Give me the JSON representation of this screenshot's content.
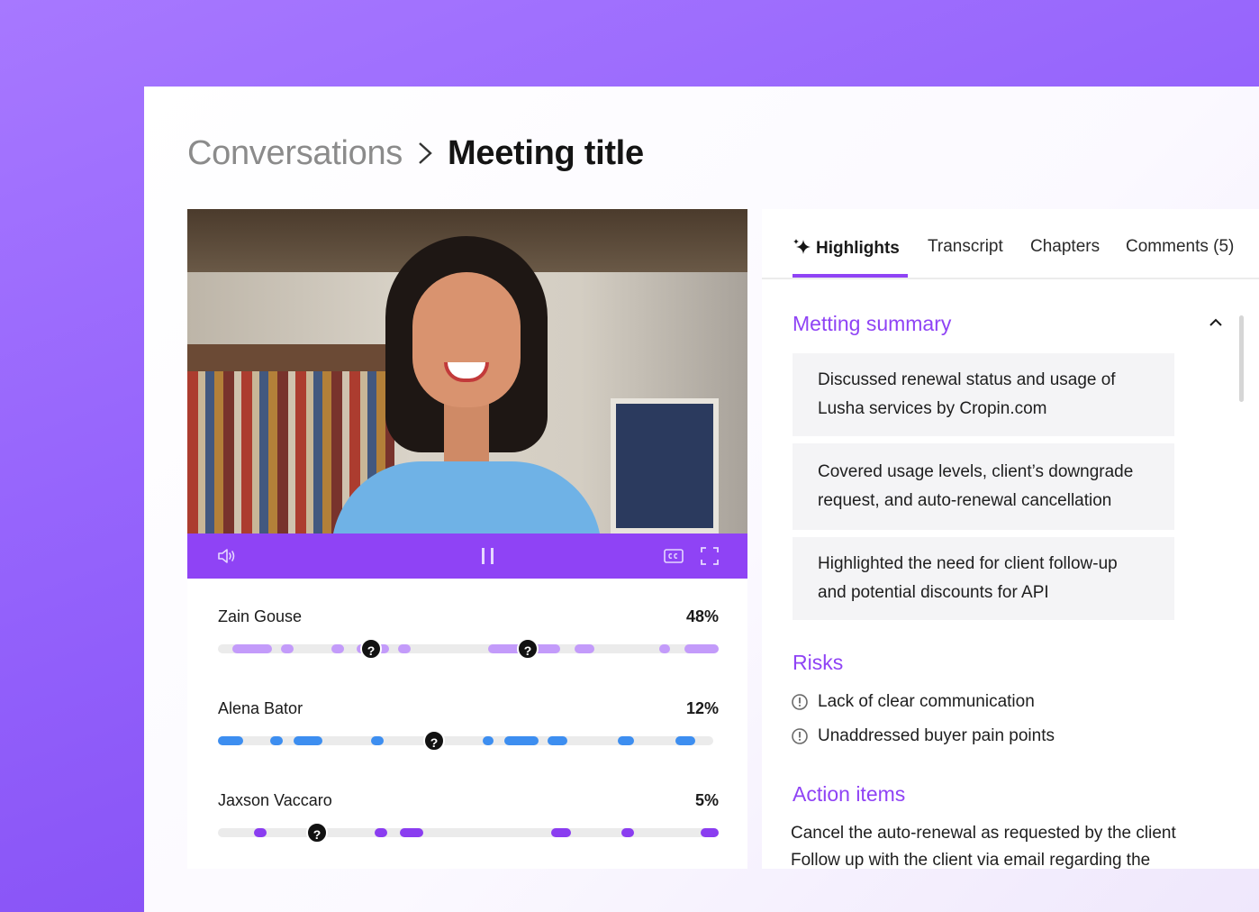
{
  "breadcrumb": {
    "parent": "Conversations",
    "current": "Meeting title"
  },
  "player": {
    "controls": [
      "volume-icon",
      "pause-icon",
      "captions-icon",
      "fullscreen-icon"
    ]
  },
  "colors": {
    "accent": "#8f43f5",
    "speaker_lilac": "#c39bfa",
    "speaker_blue": "#3d8ef0",
    "speaker_violet": "#8a3df0"
  },
  "speakers": [
    {
      "name": "Zain Gouse",
      "percent": "48%"
    },
    {
      "name": "Alena Bator",
      "percent": "12%"
    },
    {
      "name": "Jaxson Vaccaro",
      "percent": "5%"
    }
  ],
  "question_marker": "?",
  "tabs": [
    {
      "label": "Highlights",
      "active": true,
      "icon": "sparkle-icon"
    },
    {
      "label": "Transcript",
      "active": false
    },
    {
      "label": "Chapters",
      "active": false
    },
    {
      "label": "Comments (5)",
      "active": false
    }
  ],
  "summary": {
    "title": "Metting summary",
    "items": [
      "Discussed renewal status and usage of Lusha services by Cropin.com",
      "Covered  usage levels, client’s downgrade request, and auto-renewal cancellation",
      "Highlighted the need for client follow-up and potential discounts for API"
    ]
  },
  "risks": {
    "title": "Risks",
    "items": [
      "Lack of clear communication",
      "Unaddressed buyer pain points"
    ]
  },
  "actions": {
    "title": "Action items",
    "items": [
      "Cancel the auto-renewal as requested by the client",
      "Follow up with the client via email regarding the"
    ]
  }
}
